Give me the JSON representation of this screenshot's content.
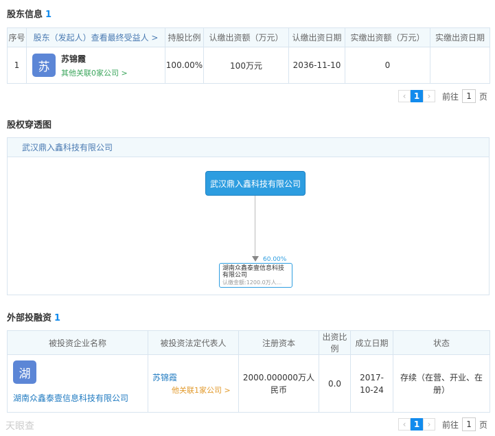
{
  "shareholders": {
    "title": "股东信息",
    "count": "1",
    "headers": [
      "序号",
      "股东（发起人）查看最终受益人 >",
      "持股比例",
      "认缴出资额（万元）",
      "认缴出资日期",
      "实缴出资额（万元）",
      "实缴出资日期"
    ],
    "rows": [
      {
        "index": "1",
        "avatar_char": "苏",
        "name": "苏锦霞",
        "related": "其他关联0家公司",
        "ratio": "100.00%",
        "subscribed": "100万元",
        "subscribed_date": "2036-11-10",
        "paid": "0",
        "paid_date": ""
      }
    ]
  },
  "pager1": {
    "prev": "‹",
    "current": "1",
    "next": "›",
    "goto": "前往",
    "page_value": "1",
    "page_unit": "页"
  },
  "equity_chart": {
    "title": "股权穿透图",
    "header_company": "武汉鼎入鑫科技有限公司",
    "root_node": "武汉鼎入鑫科技有限公司",
    "edge_percent": "60.00%",
    "child_name": "湖南众鑫泰壹信息科技有限公司",
    "child_sub": "认缴金额:1200.0万人..."
  },
  "investments": {
    "title": "外部投融资",
    "count": "1",
    "headers": [
      "被投资企业名称",
      "被投资法定代表人",
      "注册资本",
      "出资比例",
      "成立日期",
      "状态"
    ],
    "rows": [
      {
        "avatar_char": "湖",
        "company": "湖南众鑫泰壹信息科技有限公司",
        "rep_name": "苏锦霞",
        "rep_related": "他关联1家公司",
        "capital": "2000.000000万人民币",
        "ratio": "0.0",
        "date": "2017-10-24",
        "status": "存续（在营、开业、在册）"
      }
    ]
  },
  "pager2": {
    "prev": "‹",
    "current": "1",
    "next": "›",
    "goto": "前往",
    "page_value": "1",
    "page_unit": "页"
  },
  "watermark": "天眼查"
}
